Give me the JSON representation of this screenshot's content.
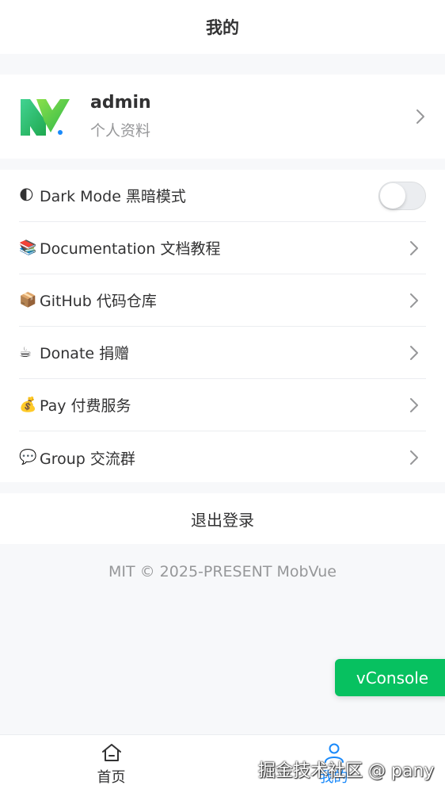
{
  "navbar": {
    "title": "我的"
  },
  "profile": {
    "username": "admin",
    "subtitle": "个人资料",
    "logo_icon": "mobvue-logo-icon"
  },
  "menu": {
    "items": [
      {
        "emoji": "🌓",
        "icon": "moon-icon",
        "label": "Dark Mode 黑暗模式",
        "type": "switch",
        "switch_on": false
      },
      {
        "emoji": "📚",
        "icon": "books-icon",
        "label": "Documentation 文档教程",
        "type": "link"
      },
      {
        "emoji": "📦",
        "icon": "package-icon",
        "label": "GitHub 代码仓库",
        "type": "link"
      },
      {
        "emoji": "☕",
        "icon": "coffee-icon",
        "label": "Donate 捐赠",
        "type": "link"
      },
      {
        "emoji": "💰",
        "icon": "money-bag-icon",
        "label": "Pay 付费服务",
        "type": "link"
      },
      {
        "emoji": "💬",
        "icon": "speech-bubble-icon",
        "label": "Group 交流群",
        "type": "link"
      }
    ]
  },
  "logout": {
    "label": "退出登录"
  },
  "footer": {
    "text": "MIT © 2025-PRESENT MobVue"
  },
  "vconsole": {
    "label": "vConsole"
  },
  "tabbar": {
    "tabs": [
      {
        "label": "首页",
        "icon": "home-icon",
        "active": false
      },
      {
        "label": "我的",
        "icon": "user-icon",
        "active": true
      }
    ]
  },
  "watermark": {
    "text": "掘金技术社区 @ pany"
  },
  "colors": {
    "accent": "#1989fa",
    "vconsole_green": "#07c160",
    "page_bg": "#f7f8fa",
    "muted_text": "#969799"
  }
}
